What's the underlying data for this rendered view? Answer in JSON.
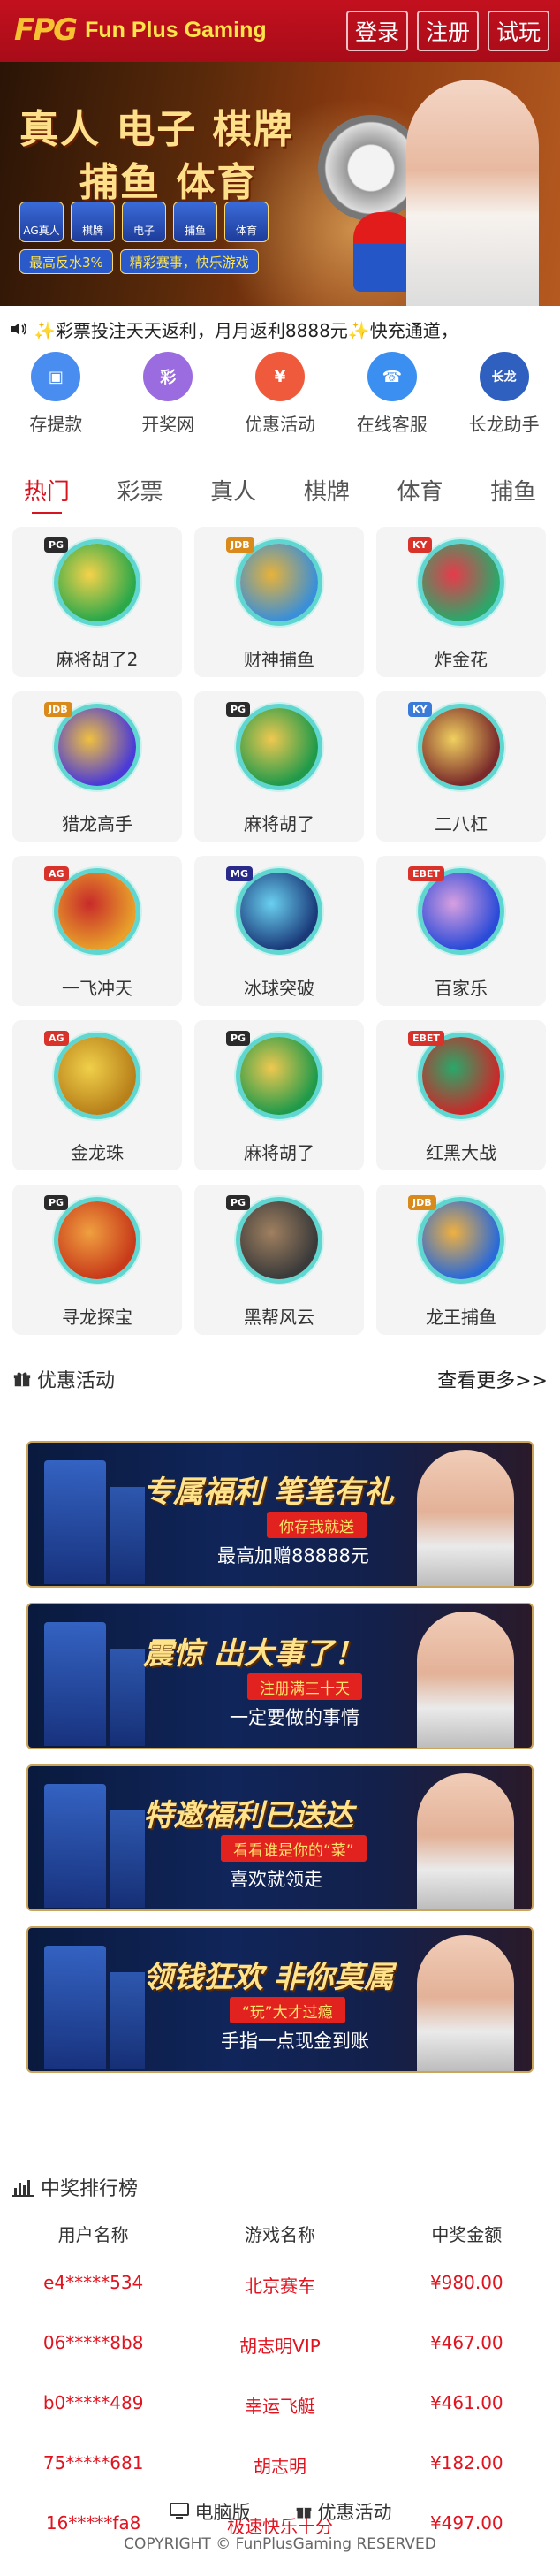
{
  "header": {
    "logo_mark": "FPG",
    "logo_text": "Fun Plus Gaming",
    "login": "登录",
    "register": "注册",
    "trial": "试玩"
  },
  "banner": {
    "line1": "真人 电子 棋牌",
    "line2": "捕鱼 体育",
    "categories": [
      "AG真人",
      "棋牌",
      "电子",
      "捕鱼",
      "体育"
    ],
    "tags": [
      "最高反水3%",
      "精彩赛事，快乐游戏"
    ]
  },
  "marquee": "✨彩票投注天天返利，月月返利8888元✨快充通道，",
  "quick_links": [
    {
      "label": "存提款",
      "icon": "wallet-icon",
      "color": "#4a8df0",
      "glyph": "▣"
    },
    {
      "label": "开奖网",
      "icon": "lottery-icon",
      "color": "#9b6be0",
      "glyph": "彩"
    },
    {
      "label": "优惠活动",
      "icon": "promotion-icon",
      "color": "#f05a3c",
      "glyph": "¥"
    },
    {
      "label": "在线客服",
      "icon": "support-icon",
      "color": "#3b8ff0",
      "glyph": "☎"
    },
    {
      "label": "长龙助手",
      "icon": "dragon-assistant-icon",
      "color": "#2f5fbf",
      "glyph": "长龙"
    }
  ],
  "tabs": [
    "热门",
    "彩票",
    "真人",
    "棋牌",
    "体育",
    "捕鱼"
  ],
  "games": [
    {
      "name": "麻将胡了2",
      "badge": "PG",
      "badge_color": "#2b2b2b",
      "c1": "#2aa84a",
      "c2": "#f6d24a"
    },
    {
      "name": "财神捕鱼",
      "badge": "JDB",
      "badge_color": "#d98a1a",
      "c1": "#3a8fd8",
      "c2": "#e8b23a"
    },
    {
      "name": "炸金花",
      "badge": "KY",
      "badge_color": "#d9322a",
      "c1": "#2aa86a",
      "c2": "#e83a4a"
    },
    {
      "name": "猎龙高手",
      "badge": "JDB",
      "badge_color": "#d98a1a",
      "c1": "#4a3ad8",
      "c2": "#f0c040"
    },
    {
      "name": "麻将胡了",
      "badge": "PG",
      "badge_color": "#2b2b2b",
      "c1": "#1f9a4a",
      "c2": "#f0c850"
    },
    {
      "name": "二八杠",
      "badge": "KY",
      "badge_color": "#3a7ad8",
      "c1": "#7a2a2a",
      "c2": "#f0d060"
    },
    {
      "name": "一飞冲天",
      "badge": "AG",
      "badge_color": "#d9322a",
      "c1": "#e8a02a",
      "c2": "#c82a2a"
    },
    {
      "name": "冰球突破",
      "badge": "MG",
      "badge_color": "#2a2a8a",
      "c1": "#1a3a7a",
      "c2": "#6ad0f0"
    },
    {
      "name": "百家乐",
      "badge": "EBET",
      "badge_color": "#d9322a",
      "c1": "#2a4ad8",
      "c2": "#d8a0e0"
    },
    {
      "name": "金龙珠",
      "badge": "AG",
      "badge_color": "#d9322a",
      "c1": "#b8801a",
      "c2": "#f0d04a"
    },
    {
      "name": "麻将胡了",
      "badge": "PG",
      "badge_color": "#2b2b2b",
      "c1": "#1f9a4a",
      "c2": "#f0c850"
    },
    {
      "name": "红黑大战",
      "badge": "EBET",
      "badge_color": "#d9322a",
      "c1": "#c82a2a",
      "c2": "#2aa86a"
    },
    {
      "name": "寻龙探宝",
      "badge": "PG",
      "badge_color": "#2b2b2b",
      "c1": "#c83a1a",
      "c2": "#f0a040"
    },
    {
      "name": "黑帮风云",
      "badge": "PG",
      "badge_color": "#2b2b2b",
      "c1": "#3a3a3a",
      "c2": "#a08060"
    },
    {
      "name": "龙王捕鱼",
      "badge": "JDB",
      "badge_color": "#d98a1a",
      "c1": "#2a6ad8",
      "c2": "#f0b040"
    }
  ],
  "promotions_section": {
    "title": "优惠活动",
    "more": "查看更多>>"
  },
  "promotions": [
    {
      "title": "专属福利 笔笔有礼",
      "sub": "你存我就送",
      "line": "最高加赠88888元"
    },
    {
      "title": "震惊 出大事了！",
      "sub": "注册满三十天",
      "line": "一定要做的事情"
    },
    {
      "title": "特邀福利已送达",
      "sub": "看看谁是你的“菜”",
      "line": "喜欢就领走"
    },
    {
      "title": "领钱狂欢 非你莫属",
      "sub": "“玩”大才过瘾",
      "line": "手指一点现金到账"
    }
  ],
  "leaderboard": {
    "title": "中奖排行榜",
    "columns": [
      "用户名称",
      "游戏名称",
      "中奖金额"
    ],
    "rows": [
      [
        "e4*****534",
        "北京赛车",
        "¥980.00"
      ],
      [
        "06*****8b8",
        "胡志明VIP",
        "¥467.00"
      ],
      [
        "b0*****489",
        "幸运飞艇",
        "¥461.00"
      ],
      [
        "75*****681",
        "胡志明",
        "¥182.00"
      ],
      [
        "16*****fa8",
        "极速快乐十分",
        "¥497.00"
      ]
    ]
  },
  "footer": {
    "desktop": "电脑版",
    "promotions": "优惠活动",
    "copyright": "COPYRIGHT © FunPlusGaming RESERVED"
  }
}
